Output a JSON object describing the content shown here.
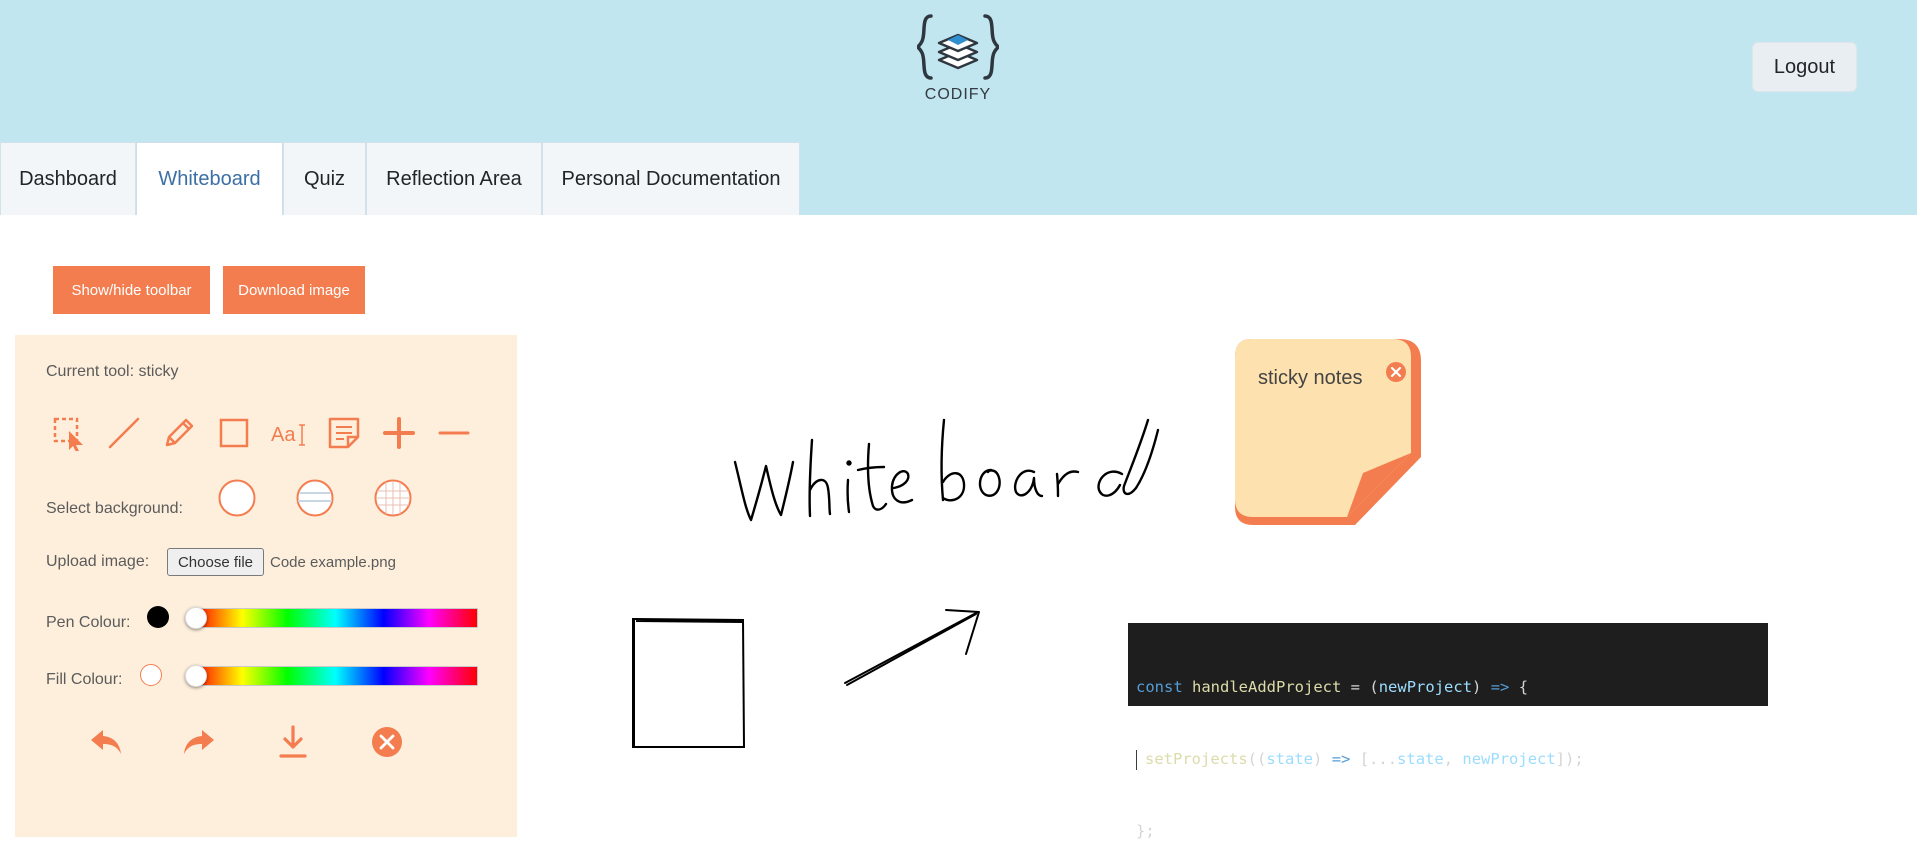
{
  "header": {
    "logo_text": "CODIFY",
    "logout_label": "Logout",
    "background_color": "#c1e6f0"
  },
  "tabs": [
    {
      "label": "Dashboard",
      "active": false
    },
    {
      "label": "Whiteboard",
      "active": true
    },
    {
      "label": "Quiz",
      "active": false
    },
    {
      "label": "Reflection Area",
      "active": false
    },
    {
      "label": "Personal Documentation",
      "active": false
    }
  ],
  "actions": {
    "toggle_toolbar_label": "Show/hide toolbar",
    "download_label": "Download image",
    "accent_color": "#f47d50"
  },
  "toolbar": {
    "current_tool_label": "Current tool: sticky",
    "tools": [
      {
        "icon": "select-icon"
      },
      {
        "icon": "line-icon"
      },
      {
        "icon": "pencil-icon"
      },
      {
        "icon": "rectangle-icon"
      },
      {
        "icon": "text-icon",
        "glyph": "Aa"
      },
      {
        "icon": "sticky-note-icon"
      },
      {
        "icon": "zoom-in-icon"
      },
      {
        "icon": "zoom-out-icon"
      }
    ],
    "background_label": "Select background:",
    "backgrounds": [
      "blank",
      "lined",
      "grid"
    ],
    "upload_label": "Upload image:",
    "choose_file_label": "Choose file",
    "file_name": "Code example.png",
    "pen_colour_label": "Pen Colour:",
    "pen_colour": "#000000",
    "pen_slider_value": 0,
    "fill_colour_label": "Fill Colour:",
    "fill_colour": "#ffffff",
    "fill_slider_value": 0,
    "bottom_actions": [
      {
        "icon": "undo-icon"
      },
      {
        "icon": "redo-icon"
      },
      {
        "icon": "download-icon"
      },
      {
        "icon": "clear-icon"
      }
    ],
    "panel_color": "#feefdc"
  },
  "canvas": {
    "handwritten_text": "Whiteboard",
    "sticky_note": {
      "text": "sticky notes",
      "color": "#fde2af",
      "fold_color": "#f47d50"
    },
    "code_image": {
      "lines": [
        "const handleAddProject = (newProject) => {",
        "  setProjects((state) => [...state, newProject]);",
        "};"
      ]
    }
  }
}
